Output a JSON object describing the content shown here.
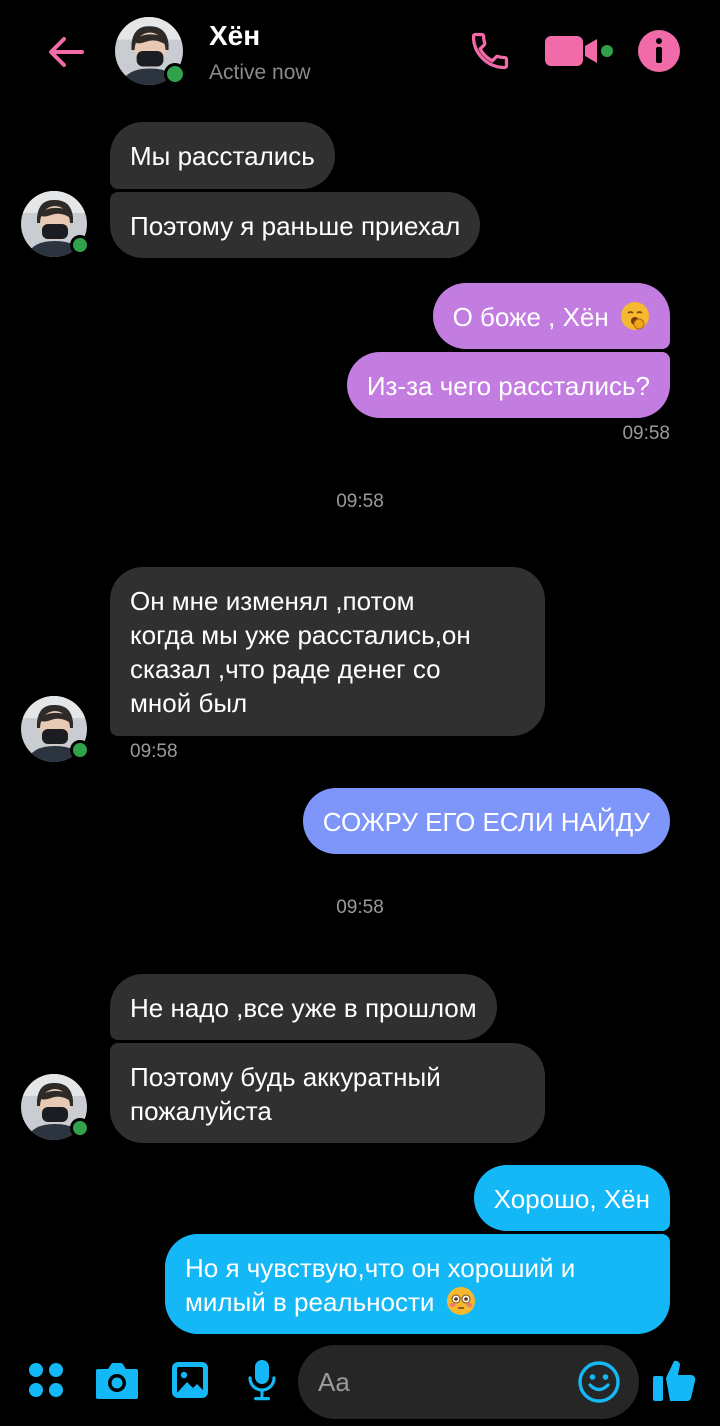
{
  "header": {
    "contact_name": "Хён",
    "status": "Active now"
  },
  "messages": {
    "m1": "Мы расстались",
    "m2": "Поэтому я раньше приехал",
    "m3": "О боже , Хён",
    "m4": "Из-за чего расстались?",
    "m4_time": "09:58",
    "sep1": "09:58",
    "m5_l1": "Он мне изменял ,потом",
    "m5_l2": "когда мы уже расстались,он",
    "m5_l3": "сказал ,что раде денег со",
    "m5_l4": "мной был",
    "m5_time": "09:58",
    "m6": "СОЖРУ ЕГО ЕСЛИ НАЙДУ",
    "sep2": "09:58",
    "m7": "Не надо ,все уже в прошлом",
    "m8_l1": "Поэтому будь аккуратный",
    "m8_l2": "пожалуйста",
    "m9": "Хорошо, Хён",
    "m10_l1": "Но я чувствую,что он хороший и",
    "m10_l2": "милый в реальности"
  },
  "composer": {
    "placeholder": "Aa"
  },
  "icons": {
    "back": "back-arrow-icon",
    "call": "phone-icon",
    "video": "video-camera-icon",
    "info": "info-icon",
    "menu": "four-dots-icon",
    "camera": "camera-icon",
    "gallery": "image-icon",
    "mic": "microphone-icon",
    "emoji": "smiley-icon",
    "like": "thumbs-up-icon"
  },
  "colors": {
    "accent_header": "#f06ba8",
    "accent_bottom": "#15b8f6",
    "bubble_incoming": "#303030",
    "bubble_pink": "#c37de1",
    "bubble_blue": "#7e95f9",
    "bubble_cyan": "#15b8f6",
    "online": "#31a24c"
  }
}
